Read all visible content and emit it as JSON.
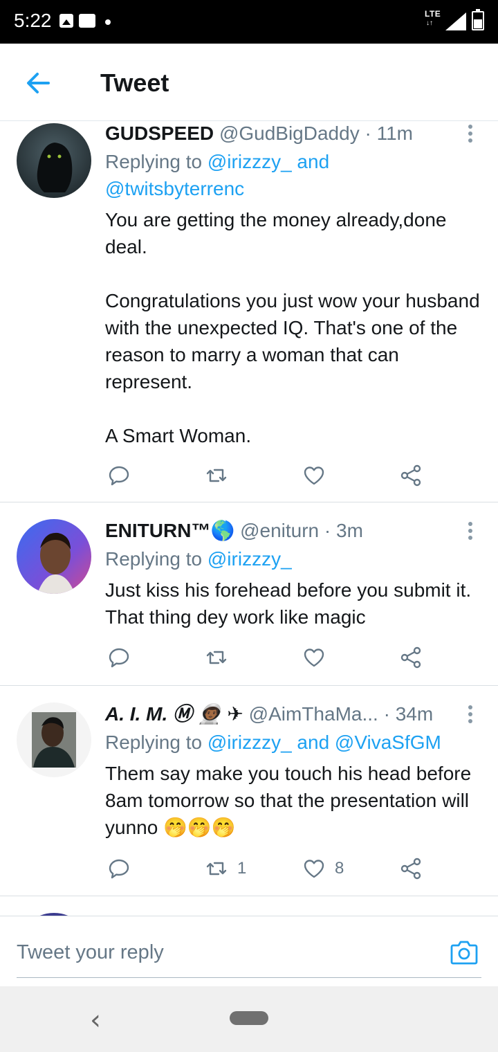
{
  "status_bar": {
    "time": "5:22",
    "network": "LTE"
  },
  "header": {
    "title": "Tweet"
  },
  "tweets": [
    {
      "name": "GUDSPEED",
      "handle": "@GudBigDaddy",
      "time": "11m",
      "replying_prefix": "Replying to ",
      "replying_to_1": "@irizzzy_",
      "replying_and": " and ",
      "replying_to_2": "@twitsbyterrenc",
      "text": "You are getting the money already,done deal.\n\nCongratulations you just wow your husband with the unexpected IQ. That's one of the reason to marry a woman that can represent.\n\nA Smart Woman.",
      "retweets": "",
      "likes": ""
    },
    {
      "name": "ENITURN™🌎",
      "handle": "@eniturn",
      "time": "3m",
      "replying_prefix": "Replying to ",
      "replying_to_1": "@irizzzy_",
      "text": "Just kiss his forehead before you submit it. That thing dey work like magic",
      "retweets": "",
      "likes": ""
    },
    {
      "name": "A. I. M. Ⓜ 👨🏾‍🚀 ✈",
      "handle": "@AimThaMa...",
      "time": "34m",
      "replying_prefix": "Replying to ",
      "replying_to_1": "@irizzzy_",
      "replying_and": " and ",
      "replying_to_2": "@VivaSfGM",
      "text": "Them say make you touch his head before 8am tomorrow so that the presentation will yunno 🤭🤭🤭",
      "retweets": "1",
      "likes": "8"
    }
  ],
  "reply_bar": {
    "placeholder": "Tweet your reply"
  },
  "colors": {
    "accent": "#1da1f2",
    "secondary_text": "#657786",
    "primary_text": "#14171a"
  },
  "icons": [
    "arrow-left-icon",
    "more-vertical-icon",
    "reply-icon",
    "retweet-icon",
    "heart-icon",
    "share-icon",
    "camera-icon",
    "nav-back-icon",
    "nav-home-pill"
  ]
}
